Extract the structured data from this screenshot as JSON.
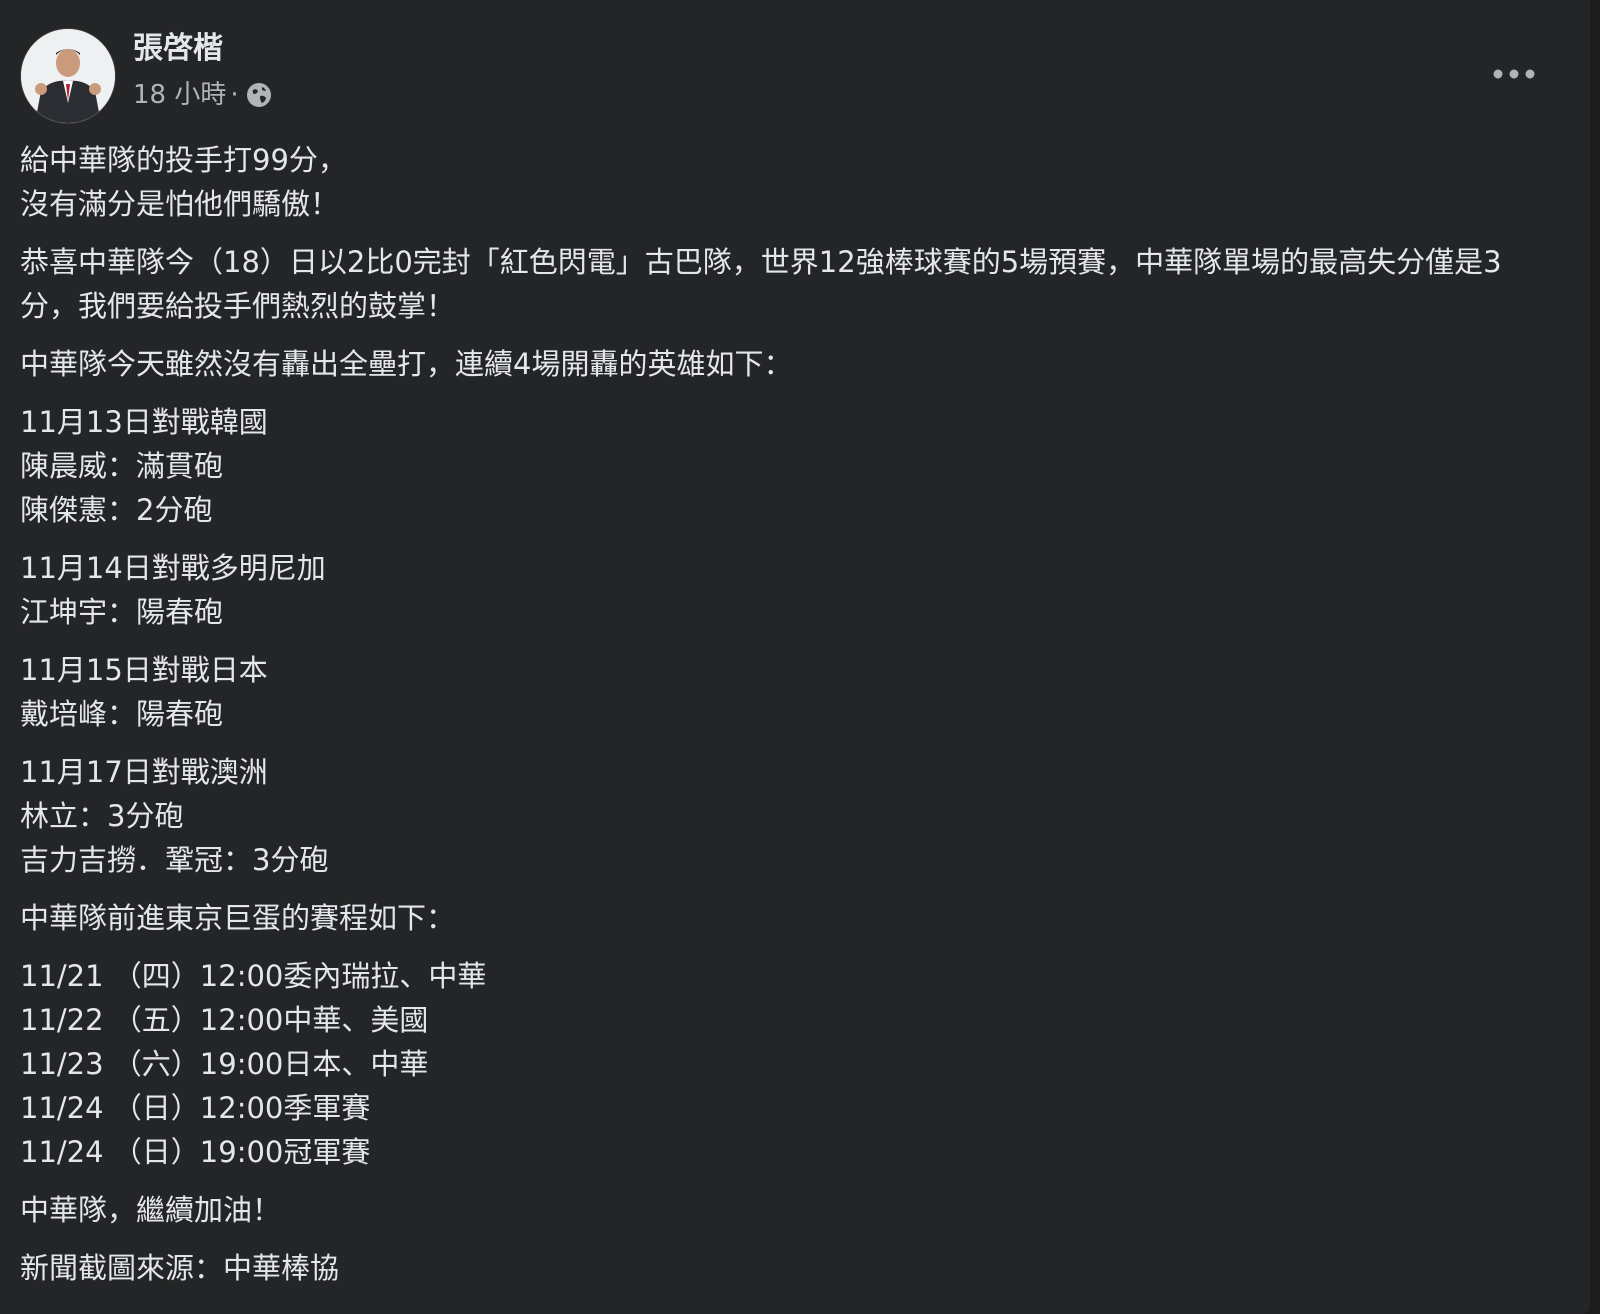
{
  "post": {
    "author": "張啓楷",
    "time": "18 小時",
    "separator": "·",
    "privacy_icon": "globe-icon",
    "more_icon": "more-options-icon",
    "avatar_icon": "profile-avatar"
  },
  "content": {
    "p1": [
      "給中華隊的投手打99分，",
      "沒有滿分是怕他們驕傲！"
    ],
    "p2": "恭喜中華隊今（18）日以2比0完封「紅色閃電」古巴隊，世界12強棒球賽的5場預賽，中華隊單場的最高失分僅是3分，我們要給投手們熱烈的鼓掌！",
    "p3": "中華隊今天雖然沒有轟出全壘打，連續4場開轟的英雄如下：",
    "p4": [
      "11月13日對戰韓國",
      "陳晨威：滿貫砲",
      "陳傑憲：2分砲"
    ],
    "p5": [
      "11月14日對戰多明尼加",
      "江坤宇：陽春砲"
    ],
    "p6": [
      "11月15日對戰日本",
      "戴培峰：陽春砲"
    ],
    "p7": [
      "11月17日對戰澳洲",
      "林立：3分砲",
      "吉力吉撈．鞏冠：3分砲"
    ],
    "p8": "中華隊前進東京巨蛋的賽程如下：",
    "p9": [
      "11/21 （四）12:00委內瑞拉、中華",
      "11/22 （五）12:00中華、美國",
      "11/23 （六）19:00日本、中華",
      "11/24 （日）12:00季軍賽",
      "11/24 （日）19:00冠軍賽"
    ],
    "p10": "中華隊，繼續加油！",
    "p11": "新聞截圖來源：中華棒協"
  },
  "colors": {
    "card_bg": "#242526",
    "text_primary": "#e4e6eb",
    "text_secondary": "#b0b3b8"
  }
}
